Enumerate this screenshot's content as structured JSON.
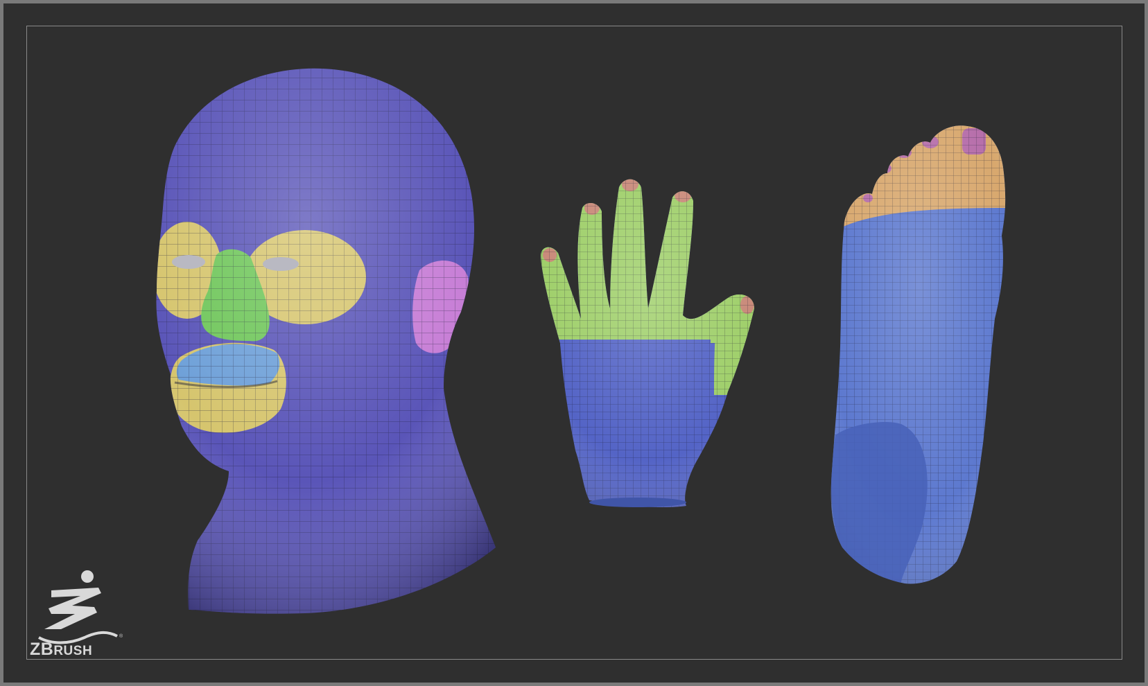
{
  "app": {
    "name": "ZBrush",
    "logo": {
      "text_lead": "ZB",
      "text_rest": "RUSH",
      "trademark": "®"
    }
  },
  "viewport": {
    "background": "#2f2f2f",
    "border_color": "#8a8a8a"
  },
  "models": [
    {
      "id": "head",
      "icon": "head-mesh",
      "polygroups": [
        "#5a55b8",
        "#d6c56e",
        "#6fc65a",
        "#6ea0d8",
        "#c77ed6"
      ]
    },
    {
      "id": "hand",
      "icon": "hand-mesh",
      "polygroups": [
        "#5464c6",
        "#9fcf6a",
        "#c98a7a"
      ]
    },
    {
      "id": "foot",
      "icon": "foot-mesh",
      "polygroups": [
        "#5d79cf",
        "#d8a86e",
        "#b66eaa"
      ]
    }
  ]
}
